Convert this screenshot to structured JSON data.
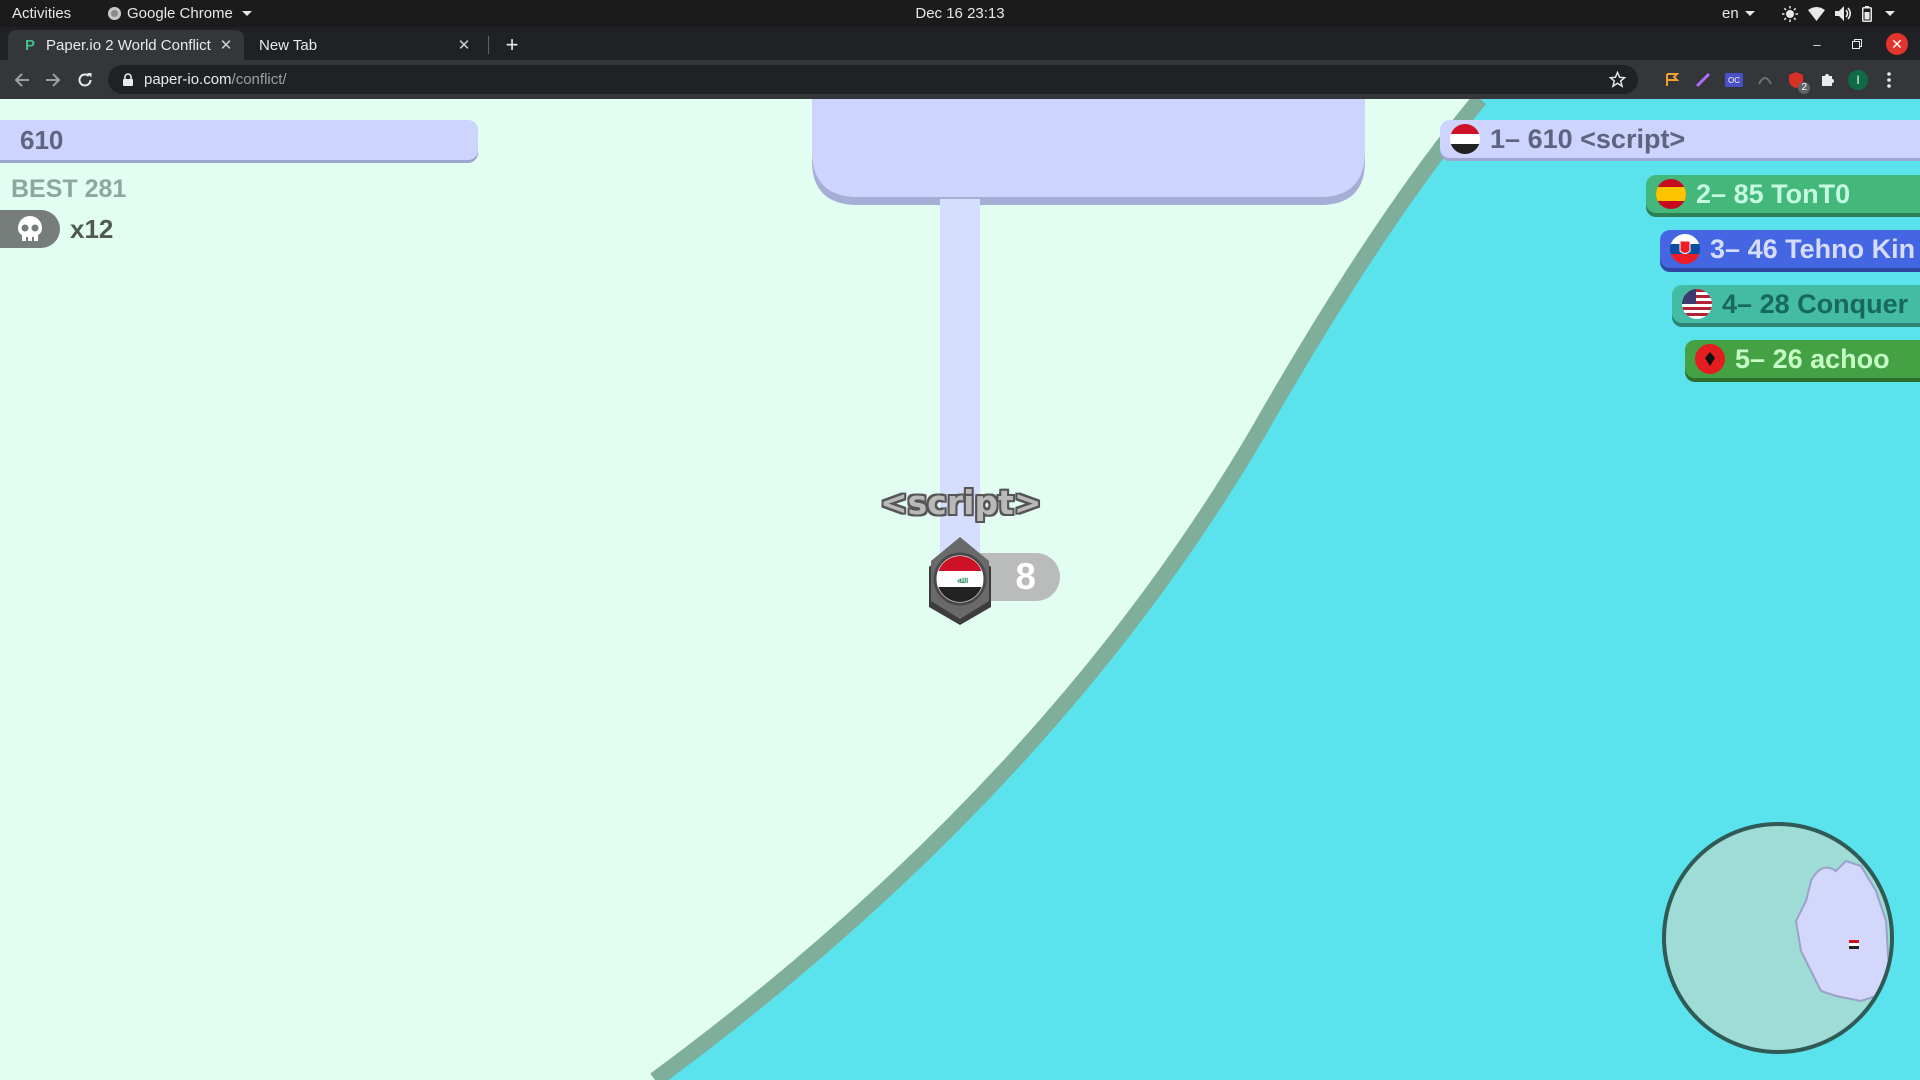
{
  "os_topbar": {
    "activities": "Activities",
    "app_name": "Google Chrome",
    "clock": "Dec 16  23:13",
    "language": "en"
  },
  "browser": {
    "tabs": [
      {
        "title": "Paper.io 2 World Conflict",
        "active": true,
        "favicon": "P"
      },
      {
        "title": "New Tab",
        "active": false
      }
    ],
    "url_host": "paper-io.com",
    "url_path": "/conflict/",
    "extension_badge": "2",
    "profile_initial": "I"
  },
  "game": {
    "score": "610",
    "best": "BEST 281",
    "kills": "x12",
    "player_name": "<script>",
    "player_area_score": "8",
    "leaderboard": [
      {
        "rank": "1",
        "score": "610",
        "name": "<script>",
        "flag": "iraq-flag"
      },
      {
        "rank": "2",
        "score": "85",
        "name": "TonT0",
        "flag": "spain-flag"
      },
      {
        "rank": "3",
        "score": "46",
        "name": "Tehno Kin",
        "flag": "slovakia-flag"
      },
      {
        "rank": "4",
        "score": "28",
        "name": "Conquer",
        "flag": "usa-flag"
      },
      {
        "rank": "5",
        "score": "26",
        "name": "achoo",
        "flag": "albania-flag"
      }
    ],
    "colors": {
      "player_territory": "#cdd4fd",
      "enemy_territory": "#5ae3ec",
      "enemy_border": "#7fae9a",
      "background": "#e2fdf2"
    }
  }
}
